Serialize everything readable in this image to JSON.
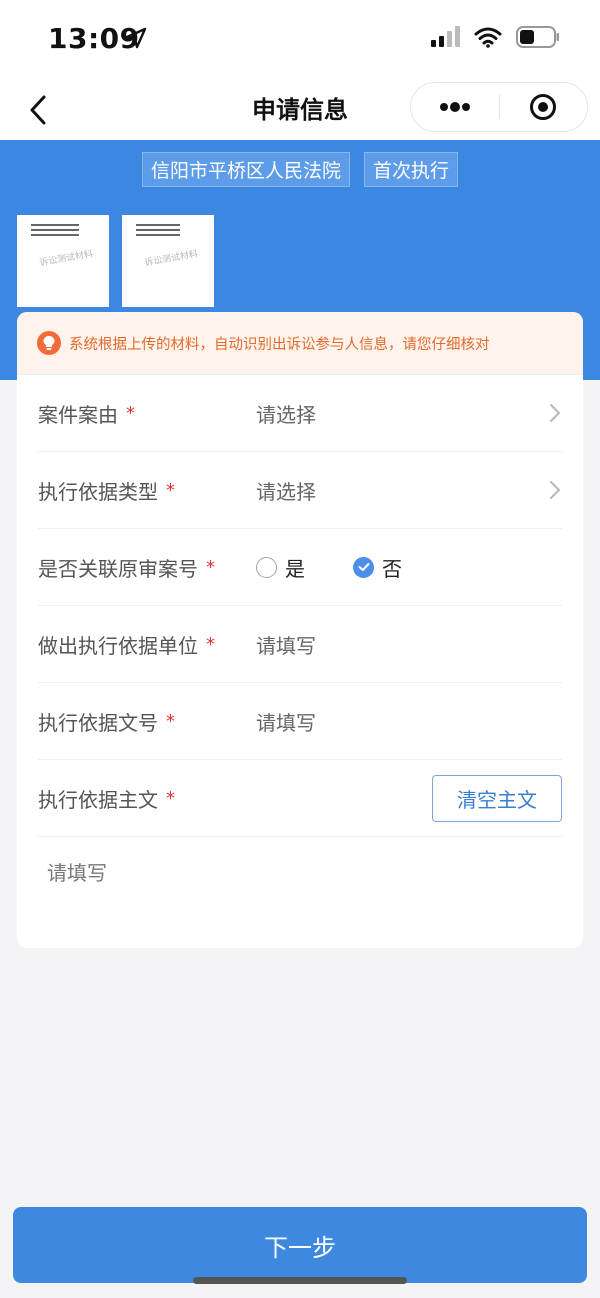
{
  "status_bar": {
    "time": "13:09"
  },
  "nav": {
    "title": "申请信息"
  },
  "header": {
    "tags": [
      "信阳市平桥区人民法院",
      "首次执行"
    ],
    "thumbnails": [
      {
        "watermark": "诉讼测试材料"
      },
      {
        "watermark": "诉讼测试材料"
      }
    ]
  },
  "notice": {
    "text": "系统根据上传的材料，自动识别出诉讼参与人信息，请您仔细核对"
  },
  "form": {
    "required_mark": "*",
    "rows": [
      {
        "label": "案件案由",
        "value": "请选择"
      },
      {
        "label": "执行依据类型",
        "value": "请选择"
      },
      {
        "label": "是否关联原审案号",
        "options": [
          "是",
          "否"
        ],
        "selected": "否"
      },
      {
        "label": "做出执行依据单位",
        "value": "请填写"
      },
      {
        "label": "执行依据文号",
        "value": "请填写"
      },
      {
        "label": "执行依据主文",
        "button": "清空主文"
      }
    ],
    "textarea_placeholder": "请填写"
  },
  "footer": {
    "next_label": "下一步"
  },
  "colors": {
    "primary": "#3b87e2",
    "required": "#e5322d",
    "notice": "#e26a2c"
  }
}
